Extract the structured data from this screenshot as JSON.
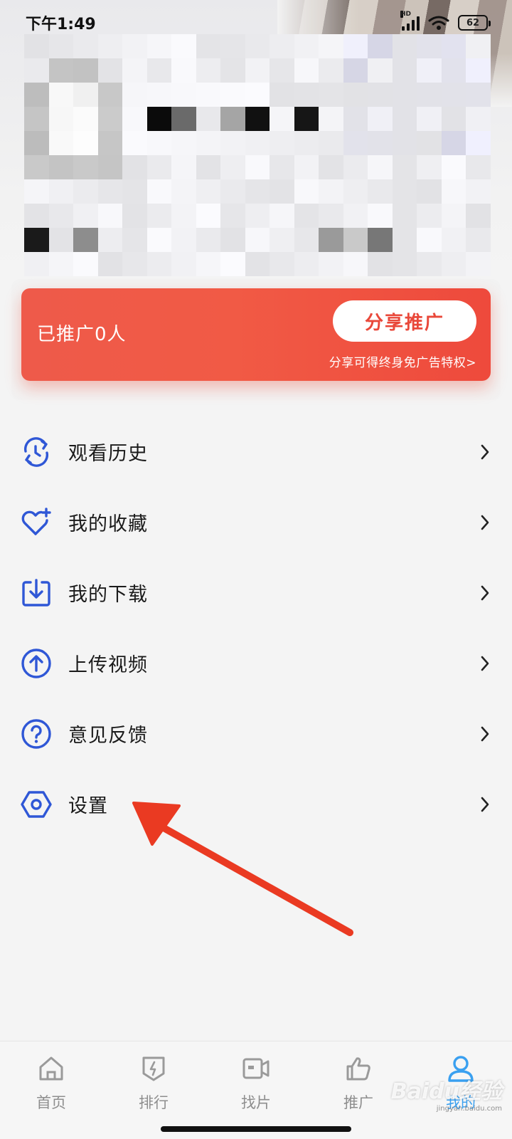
{
  "status_bar": {
    "time": "下午1:49",
    "network": "HD",
    "battery": "62"
  },
  "promo": {
    "count_text": "已推广0人",
    "share_button": "分享推广",
    "subtitle": "分享可得终身免广告特权>"
  },
  "menu": {
    "items": [
      {
        "label": "观看历史",
        "icon": "history-icon"
      },
      {
        "label": "我的收藏",
        "icon": "heart-plus-icon"
      },
      {
        "label": "我的下载",
        "icon": "download-icon"
      },
      {
        "label": "上传视频",
        "icon": "upload-icon"
      },
      {
        "label": "意见反馈",
        "icon": "question-icon"
      },
      {
        "label": "设置",
        "icon": "settings-icon"
      }
    ]
  },
  "bottom_nav": {
    "items": [
      {
        "label": "首页",
        "icon": "home-icon"
      },
      {
        "label": "排行",
        "icon": "ranking-icon"
      },
      {
        "label": "找片",
        "icon": "video-camera-icon"
      },
      {
        "label": "推广",
        "icon": "thumbs-up-icon"
      },
      {
        "label": "我的",
        "icon": "user-icon",
        "active": true
      }
    ]
  },
  "watermark": {
    "text": "Baidu经验",
    "sub": "jingyan.baidu.com"
  },
  "colors": {
    "icon_blue": "#2f57d6",
    "promo_red": "#ee4f40",
    "active_tab": "#3aa0f0",
    "annotation_arrow": "#ea3a22"
  }
}
